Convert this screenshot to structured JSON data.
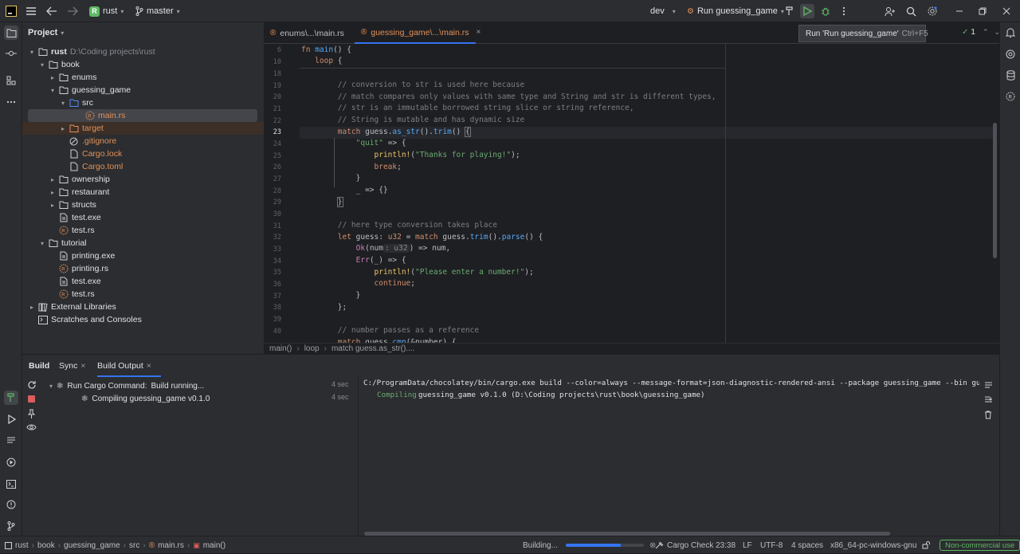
{
  "titlebar": {
    "project_badge": "R",
    "project_name": "rust",
    "branch": "master",
    "run_config_dev": "dev",
    "run_config": "Run guessing_game"
  },
  "tooltip": {
    "text": "Run 'Run guessing_game'",
    "shortcut": "Ctrl+F5"
  },
  "project_panel": {
    "title": "Project",
    "root_name": "rust",
    "root_path": "D:\\Coding projects\\rust",
    "items": [
      {
        "label": "book"
      },
      {
        "label": "enums"
      },
      {
        "label": "guessing_game"
      },
      {
        "label": "src"
      },
      {
        "label": "main.rs"
      },
      {
        "label": "target"
      },
      {
        "label": ".gitignore"
      },
      {
        "label": "Cargo.lock"
      },
      {
        "label": "Cargo.toml"
      },
      {
        "label": "ownership"
      },
      {
        "label": "restaurant"
      },
      {
        "label": "structs"
      },
      {
        "label": "test.exe"
      },
      {
        "label": "test.rs"
      },
      {
        "label": "tutorial"
      },
      {
        "label": "printing.exe"
      },
      {
        "label": "printing.rs"
      },
      {
        "label": "test.exe"
      },
      {
        "label": "test.rs"
      },
      {
        "label": "External Libraries"
      },
      {
        "label": "Scratches and Consoles"
      }
    ]
  },
  "editor": {
    "tabs": [
      {
        "label": "enums\\...\\main.rs"
      },
      {
        "label": "guessing_game\\...\\main.rs"
      }
    ],
    "inspection_count": "1",
    "line_numbers": [
      "6",
      "10",
      "18",
      "19",
      "20",
      "21",
      "22",
      "23",
      "24",
      "25",
      "26",
      "27",
      "28",
      "29",
      "30",
      "31",
      "32",
      "33",
      "34",
      "35",
      "36",
      "37",
      "38",
      "39",
      "40"
    ],
    "breadcrumbs": [
      "main()",
      "loop",
      "match guess.as_str()...."
    ]
  },
  "build": {
    "tabs": [
      "Build",
      "Sync",
      "Build Output"
    ],
    "tree": [
      {
        "label_bold": "Run Cargo Command:",
        "label": "Build running...",
        "time": "4 sec"
      },
      {
        "label": "Compiling guessing_game v0.1.0",
        "time": "4 sec"
      }
    ],
    "output_line1": "C:/ProgramData/chocolatey/bin/cargo.exe build --color=always --message-format=json-diagnostic-rendered-ansi --package guessing_game --bin guessing_game",
    "output_compiling": "Compiling",
    "output_line2": "guessing_game v0.1.0 (D:\\Coding projects\\rust\\book\\guessing_game)"
  },
  "statusbar": {
    "path": [
      "rust",
      "book",
      "guessing_game",
      "src",
      "main.rs",
      "main()"
    ],
    "building": "Building...",
    "building_progress": 0.7,
    "cargo_check": "Cargo Check",
    "position": "23:38",
    "line_sep": "LF",
    "encoding": "UTF-8",
    "indent": "4 spaces",
    "target": "x86_64-pc-windows-gnu",
    "license": "Non-commercial use"
  }
}
